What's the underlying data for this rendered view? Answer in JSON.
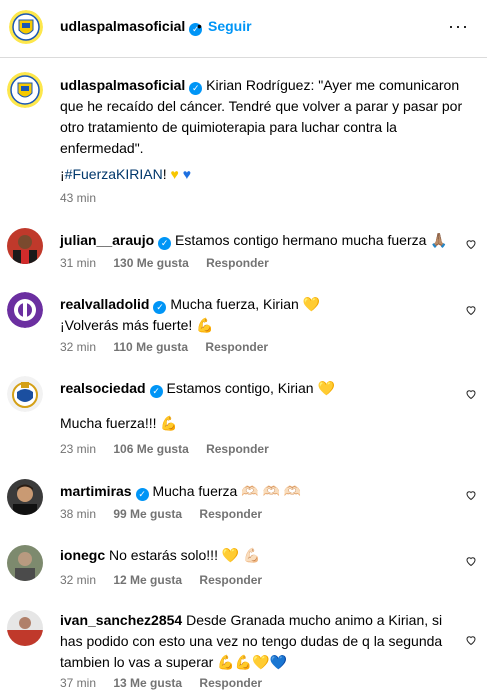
{
  "header": {
    "username": "udlaspalmasoficial",
    "separator": "•",
    "follow_label": "Seguir",
    "more_label": "···"
  },
  "caption": {
    "username": "udlaspalmasoficial",
    "text": "Kirian Rodríguez: \"Ayer me comunicaron que he recaído del cáncer. Tendré que volver a parar y pasar por otro tratamiento de quimioterapia para luchar contra la enfermedad\".",
    "hashtag_prefix": "¡",
    "hashtag": "#FuerzaKIRIAN",
    "hashtag_suffix": "!",
    "time": "43 min"
  },
  "comments": [
    {
      "username": "julian__araujo",
      "verified": true,
      "text": "Estamos contigo hermano mucha fuerza",
      "emoji": "🙏🏽",
      "time": "31 min",
      "likes": "130 Me gusta",
      "reply": "Responder"
    },
    {
      "username": "realvalladolid",
      "verified": true,
      "text": "Mucha fuerza, Kirian",
      "emoji": "💛",
      "text2": "¡Volverás más fuerte!",
      "emoji2": "💪",
      "time": "32 min",
      "likes": "110 Me gusta",
      "reply": "Responder"
    },
    {
      "username": "realsociedad",
      "verified": true,
      "text": "Estamos contigo, Kirian",
      "emoji": "💛",
      "text2": "Mucha fuerza!!!",
      "emoji2": "💪",
      "time": "23 min",
      "likes": "106 Me gusta",
      "reply": "Responder"
    },
    {
      "username": "martimiras",
      "verified": true,
      "text": "Mucha fuerza",
      "emoji": "🫶🏻 🫶🏻 🫶🏻",
      "time": "38 min",
      "likes": "99 Me gusta",
      "reply": "Responder"
    },
    {
      "username": "ionegc",
      "verified": false,
      "text": "No estarás solo!!!",
      "emoji": "💛 💪🏻",
      "time": "32 min",
      "likes": "12 Me gusta",
      "reply": "Responder"
    },
    {
      "username": "ivan_sanchez2854",
      "verified": false,
      "text": "Desde Granada mucho animo a Kirian, si has podido con esto una vez no tengo dudas de q la segunda tambien lo vas a superar",
      "emoji": "💪💪💛💙",
      "time": "37 min",
      "likes": "13 Me gusta",
      "reply": "Responder"
    }
  ],
  "colors": {
    "accent": "#0095f6",
    "secondary_text": "#737373",
    "hashtag": "#00376b"
  },
  "icons": [
    "verified-badge-icon",
    "more-options-icon",
    "heart-icon"
  ]
}
